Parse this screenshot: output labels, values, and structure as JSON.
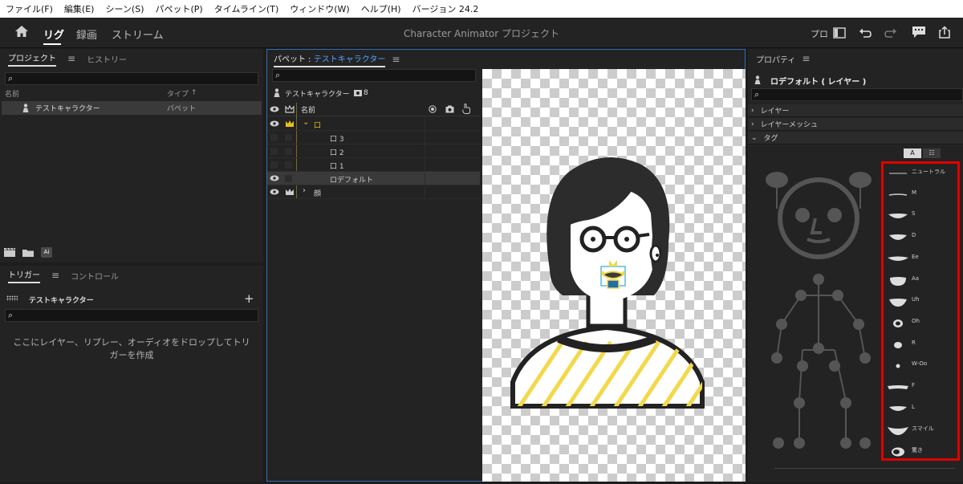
{
  "menubar": [
    "ファイル(F)",
    "編集(E)",
    "シーン(S)",
    "パペット(P)",
    "タイムライン(T)",
    "ウィンドウ(W)",
    "ヘルプ(H)",
    "バージョン 24.2"
  ],
  "appbar": {
    "modes": [
      "リグ",
      "録画",
      "ストリーム"
    ],
    "title": "Character Animator プロジェクト",
    "pro_label": "プロ"
  },
  "project_panel": {
    "tabs": [
      "プロジェクト",
      "ヒストリー"
    ],
    "col_name": "名前",
    "col_type": "タイプ",
    "item_name": "テストキャラクター",
    "item_type": "パペット"
  },
  "trigger_panel": {
    "tabs": [
      "トリガー",
      "コントロール"
    ],
    "puppet": "テストキャラクター",
    "plus": "+",
    "empty_msg_1": "ここにレイヤー、リプレー、オーディオをドロップしてトリ",
    "empty_msg_2": "ガーを作成"
  },
  "puppet_panel": {
    "tab_prefix": "パペット : ",
    "tab_name": "テストキャラクター",
    "puppet_name": "テストキャラクター",
    "count": "8",
    "col_name": "名前",
    "layers": [
      {
        "label": "口",
        "indent": 1,
        "type": "group-open"
      },
      {
        "label": "口 3",
        "indent": 2,
        "type": "item"
      },
      {
        "label": "口 2",
        "indent": 2,
        "type": "item"
      },
      {
        "label": "口 1",
        "indent": 2,
        "type": "item"
      },
      {
        "label": "ロデフォルト",
        "indent": 2,
        "type": "selected"
      },
      {
        "label": "顔",
        "indent": 1,
        "type": "group-closed"
      }
    ]
  },
  "properties_panel": {
    "tab": "プロパティ",
    "selection": "ロデフォルト ( レイヤー )",
    "sections": [
      "レイヤー",
      "レイヤーメッシュ",
      "タグ"
    ],
    "tag_toggle": [
      "A",
      "☷"
    ],
    "visemes": [
      "ニュートラル",
      "M",
      "S",
      "D",
      "Ee",
      "Aa",
      "Uh",
      "Oh",
      "R",
      "W-Oo",
      "F",
      "L",
      "スマイル",
      "驚き"
    ],
    "highlight_color": "#e00000"
  }
}
